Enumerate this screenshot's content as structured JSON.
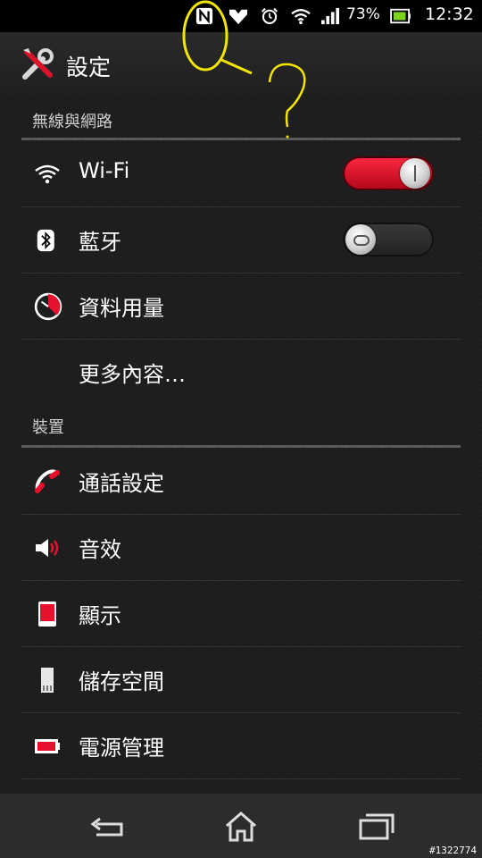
{
  "status_bar": {
    "battery_percent": "73%",
    "time": "12:32",
    "icons": [
      "nfc-icon",
      "shield-icon",
      "alarm-icon",
      "wifi-icon",
      "signal-icon",
      "battery-icon"
    ]
  },
  "header": {
    "title": "設定",
    "icon": "tools-icon"
  },
  "sections": [
    {
      "header": "無線與網路",
      "items": [
        {
          "label": "Wi-Fi",
          "icon": "wifi-icon",
          "toggle": "on"
        },
        {
          "label": "藍牙",
          "icon": "bluetooth-icon",
          "toggle": "off"
        },
        {
          "label": "資料用量",
          "icon": "data-usage-icon"
        },
        {
          "label": "更多內容…",
          "icon": ""
        }
      ]
    },
    {
      "header": "裝置",
      "items": [
        {
          "label": "通話設定",
          "icon": "phone-icon"
        },
        {
          "label": "音效",
          "icon": "speaker-icon"
        },
        {
          "label": "顯示",
          "icon": "display-icon"
        },
        {
          "label": "儲存空間",
          "icon": "sd-card-icon"
        },
        {
          "label": "電源管理",
          "icon": "battery-power-icon"
        }
      ]
    }
  ],
  "navigation": {
    "buttons": [
      "back-icon",
      "home-icon",
      "recent-apps-icon"
    ]
  },
  "watermark": "#1322774",
  "colors": {
    "accent": "#e8112d",
    "annotation": "#f2e600"
  }
}
